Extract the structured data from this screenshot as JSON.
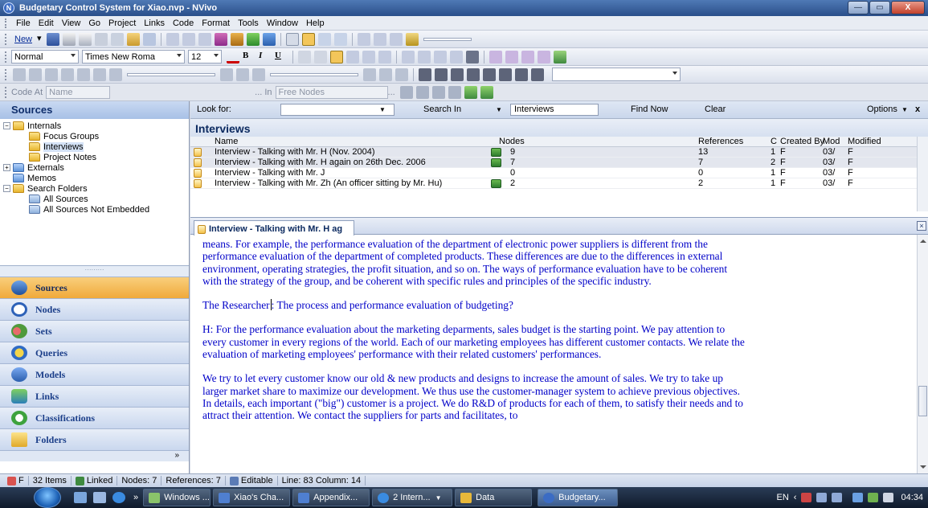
{
  "window": {
    "title": "Budgetary Control System for Xiao.nvp - NVivo",
    "app_icon": "N"
  },
  "window_buttons": {
    "minimize": "—",
    "maximize": "▭",
    "close": "X"
  },
  "menu": [
    "File",
    "Edit",
    "View",
    "Go",
    "Project",
    "Links",
    "Code",
    "Format",
    "Tools",
    "Window",
    "Help"
  ],
  "toolbar1": {
    "new_label": "New"
  },
  "toolbar2": {
    "style": "Normal",
    "font": "Times New Roma",
    "size": "12",
    "bold": "B",
    "italic": "I",
    "underline": "U"
  },
  "toolbar4": {
    "code_at_label": "Code At",
    "name_field": "Name",
    "in_label": "... In",
    "free_nodes": "Free Nodes",
    "ellipsis": "..."
  },
  "left_panel": {
    "header": "Sources",
    "tree": [
      {
        "label": "Internals",
        "expander": "−"
      },
      {
        "label": "Focus Groups"
      },
      {
        "label": "Interviews"
      },
      {
        "label": "Project Notes"
      },
      {
        "label": "Externals",
        "expander": "+"
      },
      {
        "label": "Memos"
      },
      {
        "label": "Search Folders",
        "expander": "−"
      },
      {
        "label": "All Sources"
      },
      {
        "label": "All Sources Not Embedded"
      }
    ],
    "nav": [
      "Sources",
      "Nodes",
      "Sets",
      "Queries",
      "Models",
      "Links",
      "Classifications",
      "Folders"
    ],
    "nav_more": "»"
  },
  "find_bar": {
    "look_for_label": "Look for:",
    "look_for_value": "",
    "search_in_label": "Search In",
    "search_in_value": "Interviews",
    "find_now": "Find Now",
    "clear": "Clear",
    "options": "Options",
    "close": "x"
  },
  "list": {
    "title": "Interviews",
    "columns": [
      "Name",
      "Nodes",
      "References",
      "C",
      "Created By",
      "Mod",
      "Modified"
    ],
    "rows": [
      {
        "name": "Interview - Talking with Mr. H (Nov. 2004)",
        "nodes": "9",
        "references": "13",
        "c": "1",
        "created_by": "F",
        "mod": "03/",
        "modified": "F",
        "linked": true
      },
      {
        "name": "Interview - Talking with Mr. H again on 26th Dec. 2006",
        "nodes": "7",
        "references": "7",
        "c": "2",
        "created_by": "F",
        "mod": "03/",
        "modified": "F",
        "linked": true
      },
      {
        "name": "Interview - Talking with Mr. J",
        "nodes": "0",
        "references": "0",
        "c": "1",
        "created_by": "F",
        "mod": "03/",
        "modified": "F",
        "linked": false
      },
      {
        "name": "Interview - Talking with Mr. Zh (An officer sitting by Mr. Hu)",
        "nodes": "2",
        "references": "2",
        "c": "1",
        "created_by": "F",
        "mod": "03/",
        "modified": "F",
        "linked": true
      }
    ]
  },
  "document": {
    "tab_label": "Interview - Talking with Mr. H ag",
    "close": "×",
    "paragraphs": [
      "means. For example, the performance evaluation of the department of electronic power suppliers is different from the performance evaluation of the department of completed products. These differences are due to the differences in external environment, operating strategies, the profit situation, and so on. The ways of performance evaluation have to be coherent with the strategy of the group, and be coherent with specific rules and principles of the specific industry.",
      "H: For the performance evaluation about the marketing deparments, sales budget is the starting point. We pay attention to every customer in every regions of the world. Each of our marketing employees has different customer contacts. We relate the evaluation of marketing employees' performance with their related customers' performances.",
      "We try to let every customer know our old & new products and designs to increase the amount of sales. We try to take up larger market share to maximize our development. We thus use the customer-manager system to achieve previous objectives. In details, each important (\"big\") customer is a project. We do R&D of products for each of them, to satisfy their needs and to attract their attention. We contact the suppliers for parts and facilitates, to"
    ],
    "researcher_prefix": "The Researcher",
    "researcher_rest": ": The process and performance evaluation of budgeting?"
  },
  "status": [
    "F",
    "32 Items",
    "Linked",
    "Nodes: 7",
    "References: 7",
    "Editable",
    "Line: 83 Column: 14"
  ],
  "taskbar": {
    "tasks": [
      "Windows ...",
      "Xiao's Cha...",
      "Appendix...",
      "2 Intern...",
      "Data",
      "Budgetary..."
    ],
    "lang": "EN",
    "clock": "04:34"
  },
  "colors": {
    "doc_text": "#0000c8",
    "active_nav": "#f0a93a",
    "title_bar": "#2a4f8a"
  }
}
